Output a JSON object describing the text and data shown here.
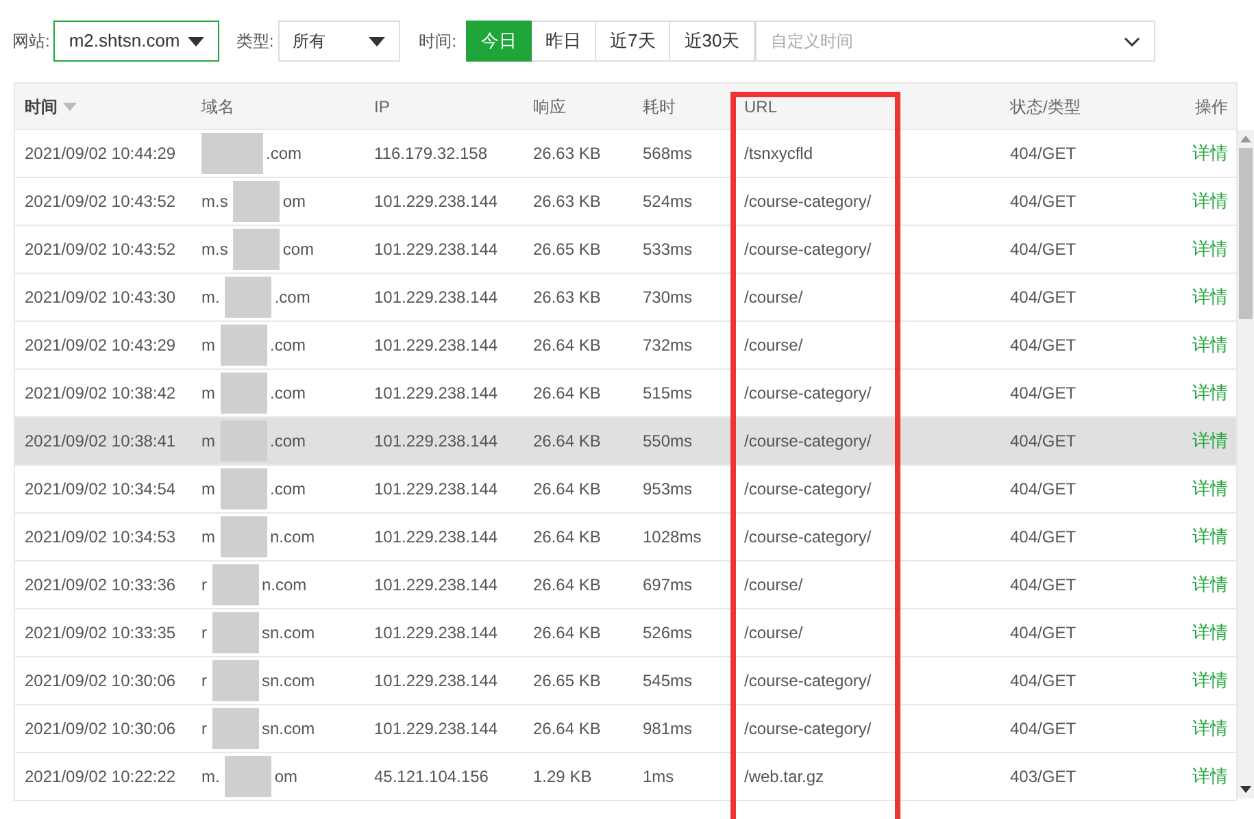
{
  "filters": {
    "site": {
      "label": "网站:",
      "value": "m2.shtsn.com"
    },
    "type": {
      "label": "类型:",
      "value": "所有"
    },
    "time": {
      "label": "时间:",
      "options": [
        {
          "label": "今日",
          "selected": true
        },
        {
          "label": "昨日",
          "selected": false
        },
        {
          "label": "近7天",
          "selected": false
        },
        {
          "label": "近30天",
          "selected": false
        }
      ],
      "custom_placeholder": "自定义时间"
    }
  },
  "table": {
    "columns": [
      "时间",
      "域名",
      "IP",
      "响应",
      "耗时",
      "URL",
      "状态/类型",
      "操作"
    ],
    "rows": [
      {
        "time": "2021/09/02 10:44:29",
        "domain_end": ".com",
        "ip": "116.179.32.158",
        "size": "26.63 KB",
        "duration": "568ms",
        "url": "/tsnxycfld",
        "status": "404/GET",
        "action": "详情",
        "highlighted": false
      },
      {
        "time": "2021/09/02 10:43:52",
        "domain_start": "m.s",
        "domain_end": "om",
        "ip": "101.229.238.144",
        "size": "26.63 KB",
        "duration": "524ms",
        "url": "/course-category/",
        "status": "404/GET",
        "action": "详情",
        "highlighted": false
      },
      {
        "time": "2021/09/02 10:43:52",
        "domain_start": "m.s",
        "domain_end": "com",
        "ip": "101.229.238.144",
        "size": "26.65 KB",
        "duration": "533ms",
        "url": "/course-category/",
        "status": "404/GET",
        "action": "详情",
        "highlighted": false
      },
      {
        "time": "2021/09/02 10:43:30",
        "domain_start": "m.",
        "domain_end": ".com",
        "ip": "101.229.238.144",
        "size": "26.63 KB",
        "duration": "730ms",
        "url": "/course/",
        "status": "404/GET",
        "action": "详情",
        "highlighted": false
      },
      {
        "time": "2021/09/02 10:43:29",
        "domain_start": "m",
        "domain_end": ".com",
        "ip": "101.229.238.144",
        "size": "26.64 KB",
        "duration": "732ms",
        "url": "/course/",
        "status": "404/GET",
        "action": "详情",
        "highlighted": false
      },
      {
        "time": "2021/09/02 10:38:42",
        "domain_start": "m",
        "domain_end": ".com",
        "ip": "101.229.238.144",
        "size": "26.64 KB",
        "duration": "515ms",
        "url": "/course-category/",
        "status": "404/GET",
        "action": "详情",
        "highlighted": false
      },
      {
        "time": "2021/09/02 10:38:41",
        "domain_start": "m",
        "domain_end": ".com",
        "ip": "101.229.238.144",
        "size": "26.64 KB",
        "duration": "550ms",
        "url": "/course-category/",
        "status": "404/GET",
        "action": "详情",
        "highlighted": true
      },
      {
        "time": "2021/09/02 10:34:54",
        "domain_start": "m",
        "domain_end": ".com",
        "ip": "101.229.238.144",
        "size": "26.64 KB",
        "duration": "953ms",
        "url": "/course-category/",
        "status": "404/GET",
        "action": "详情",
        "highlighted": false
      },
      {
        "time": "2021/09/02 10:34:53",
        "domain_start": "m",
        "domain_end": "n.com",
        "ip": "101.229.238.144",
        "size": "26.64 KB",
        "duration": "1028ms",
        "url": "/course-category/",
        "status": "404/GET",
        "action": "详情",
        "highlighted": false
      },
      {
        "time": "2021/09/02 10:33:36",
        "domain_start": "r",
        "domain_end": "n.com",
        "ip": "101.229.238.144",
        "size": "26.64 KB",
        "duration": "697ms",
        "url": "/course/",
        "status": "404/GET",
        "action": "详情",
        "highlighted": false
      },
      {
        "time": "2021/09/02 10:33:35",
        "domain_start": "r",
        "domain_end": "sn.com",
        "ip": "101.229.238.144",
        "size": "26.64 KB",
        "duration": "526ms",
        "url": "/course/",
        "status": "404/GET",
        "action": "详情",
        "highlighted": false
      },
      {
        "time": "2021/09/02 10:30:06",
        "domain_start": "r",
        "domain_end": "sn.com",
        "ip": "101.229.238.144",
        "size": "26.65 KB",
        "duration": "545ms",
        "url": "/course-category/",
        "status": "404/GET",
        "action": "详情",
        "highlighted": false
      },
      {
        "time": "2021/09/02 10:30:06",
        "domain_start": "r",
        "domain_end": "sn.com",
        "ip": "101.229.238.144",
        "size": "26.64 KB",
        "duration": "981ms",
        "url": "/course-category/",
        "status": "404/GET",
        "action": "详情",
        "highlighted": false
      },
      {
        "time": "2021/09/02 10:22:22",
        "domain_start": "m.",
        "domain_end": "om",
        "ip": "45.121.104.156",
        "size": "1.29 KB",
        "duration": "1ms",
        "url": "/web.tar.gz",
        "status": "403/GET",
        "action": "详情",
        "highlighted": false
      }
    ]
  }
}
